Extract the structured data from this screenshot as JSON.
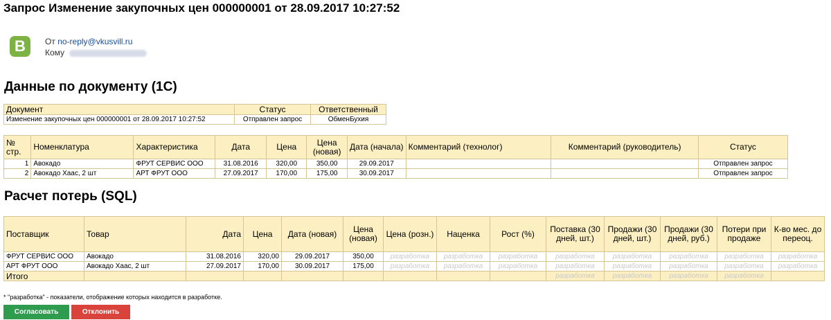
{
  "email": {
    "subject": "Запрос Изменение закупочных цен 000000001 от 28.09.2017 10:27:52",
    "sender_logo": "B",
    "from_label": "От",
    "from_address": "no-reply@vkusvill.ru",
    "to_label": "Кому"
  },
  "doc_section": {
    "title": "Данные по документу (1С)",
    "headers": [
      "Документ",
      "Статус",
      "Ответственный"
    ],
    "row": [
      "Изменение закупочных цен 000000001 от 28.09.2017 10:27:52",
      "Отправлен запрос",
      "ОбменБухия"
    ]
  },
  "items_table": {
    "headers": [
      "№ стр.",
      "Номенклатура",
      "Характеристика",
      "Дата",
      "Цена",
      "Цена (новая)",
      "Дата (начала)",
      "Комментарий (технолог)",
      "Комментарий (руководитель)",
      "Статус"
    ],
    "rows": [
      [
        "1",
        "Авокадо",
        "ФРУТ СЕРВИС ООО",
        "31.08.2016",
        "320,00",
        "350,00",
        "29.09.2017",
        "",
        "",
        "Отправлен запрос"
      ],
      [
        "2",
        "Авокадо Хаас, 2 шт",
        "АРТ ФРУТ ООО",
        "27.09.2017",
        "170,00",
        "175,00",
        "30.09.2017",
        "",
        "",
        "Отправлен запрос"
      ]
    ]
  },
  "loss_section": {
    "title": "Расчет потерь (SQL)",
    "headers": [
      "Поставщик",
      "Товар",
      "Дата",
      "Цена",
      "Дата (новая)",
      "Цена (новая)",
      "Цена (розн.)",
      "Наценка",
      "Рост (%)",
      "Поставка (30 дней, шт.)",
      "Продажи (30 дней, шт.)",
      "Продажи (30 дней, руб.)",
      "Потери при продаже",
      "К-во мес. до переоц."
    ],
    "rows": [
      [
        "ФРУТ СЕРВИС ООО",
        "Авокадо",
        "31.08.2016",
        "320,00",
        "29.09.2017",
        "350,00"
      ],
      [
        "АРТ ФРУТ ООО",
        "Авокадо Хаас, 2 шт",
        "27.09.2017",
        "170,00",
        "30.09.2017",
        "175,00"
      ]
    ],
    "placeholder": "разработка",
    "total_label": "Итого"
  },
  "footnote": "* \"разработка\" - показатели, отображение которых находится в разработке.",
  "buttons": {
    "approve": "Согласовать",
    "reject": "Отклонить"
  },
  "colors": {
    "header_bg": "#fcefc2",
    "border": "#d6c594",
    "approve": "#2e9b4e",
    "reject": "#d9433b"
  }
}
